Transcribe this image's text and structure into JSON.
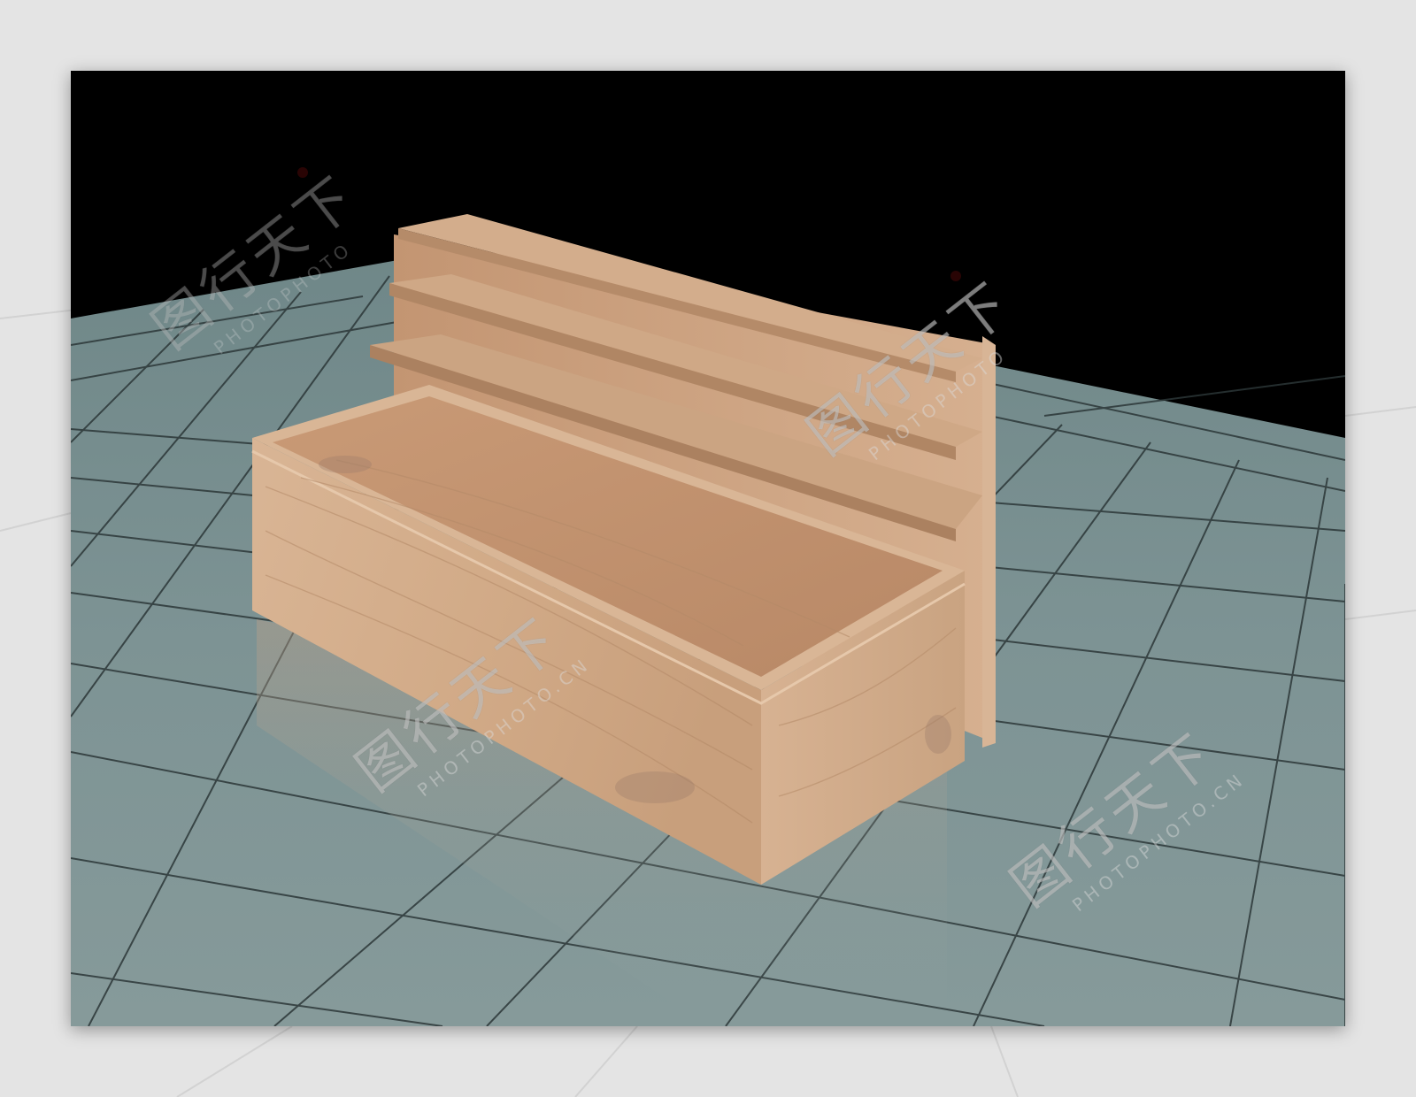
{
  "scene": {
    "subject": "wooden-display-counter-with-shelves",
    "colors": {
      "background_outer": "#e6e6e6",
      "sky": "#000000",
      "floor": "#7e9596",
      "grid_lines": "#2f3b3c",
      "wood_light": "#d8b08c",
      "wood_mid": "#c69c78",
      "wood_dark": "#a8805f"
    }
  },
  "watermarks": [
    {
      "main": "图行天下",
      "sub": "PHOTOPHOTO.CN"
    },
    {
      "main": "图行天下",
      "sub": "PHOTOPHOTO.CN"
    },
    {
      "main": "图行天下",
      "sub": "PHOTOPHOTO"
    },
    {
      "main": "图行天下",
      "sub": "PHOTOPHOTO"
    }
  ]
}
